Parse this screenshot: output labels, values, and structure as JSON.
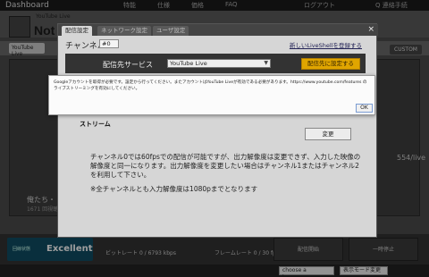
{
  "topbar": {
    "logo": "Dashboard",
    "nav": [
      "特能",
      "仕様",
      "価格",
      "FAQ",
      "ログアウト",
      "Q 連絡手続"
    ]
  },
  "background": {
    "subtitle": "YouTube Live",
    "title": "Not",
    "tab": "YouTube Live",
    "custom_button": "CUSTOM",
    "side_text": "俺たち・・",
    "side_subtext": "1671 回視聴",
    "live_text": "554/live",
    "status_label": "回線状態",
    "status_value": "Excellent",
    "bitrate_label": "ビットレート",
    "bitrate_value": "0 / 6793 kbps",
    "frame_label": "フレームレート",
    "frame_value": "0 / 30 fps",
    "stop_button": "配信開始",
    "pause_button": "一時停止",
    "language_select": "choose a language",
    "mode_select": "表示モード変更"
  },
  "modal": {
    "tabs": [
      "配信設定",
      "ネットワーク設定",
      "ユーザ設定"
    ],
    "close": "×",
    "channel_label": "チャンネル",
    "channel_value": "#0",
    "new_link": "新しいLiveShellを登録する",
    "service_label": "配信先サービス",
    "service_value": "YouTube Live",
    "set_button": "配信先に設定する",
    "stream_label": "ストリーム",
    "change_button": "変更",
    "info_text": "チャンネル0では60fpsでの配信が可能ですが、出力解像度は変更できず、入力した映像の解像度と同一になります。出力解像度を変更したい場合はチャンネル1またはチャンネル2を利用して下さい。",
    "info_note": "※全チャンネルとも入力解像度は1080pまでとなります"
  },
  "alert": {
    "message": "Googleアカウントを取得が必要です。設定から行ってください。またアカウントはYouTube Liveが有効である必要があります。https://www.youtube.com/features のライブストリーミングを有効にしてください。",
    "ok_button": "OK"
  }
}
